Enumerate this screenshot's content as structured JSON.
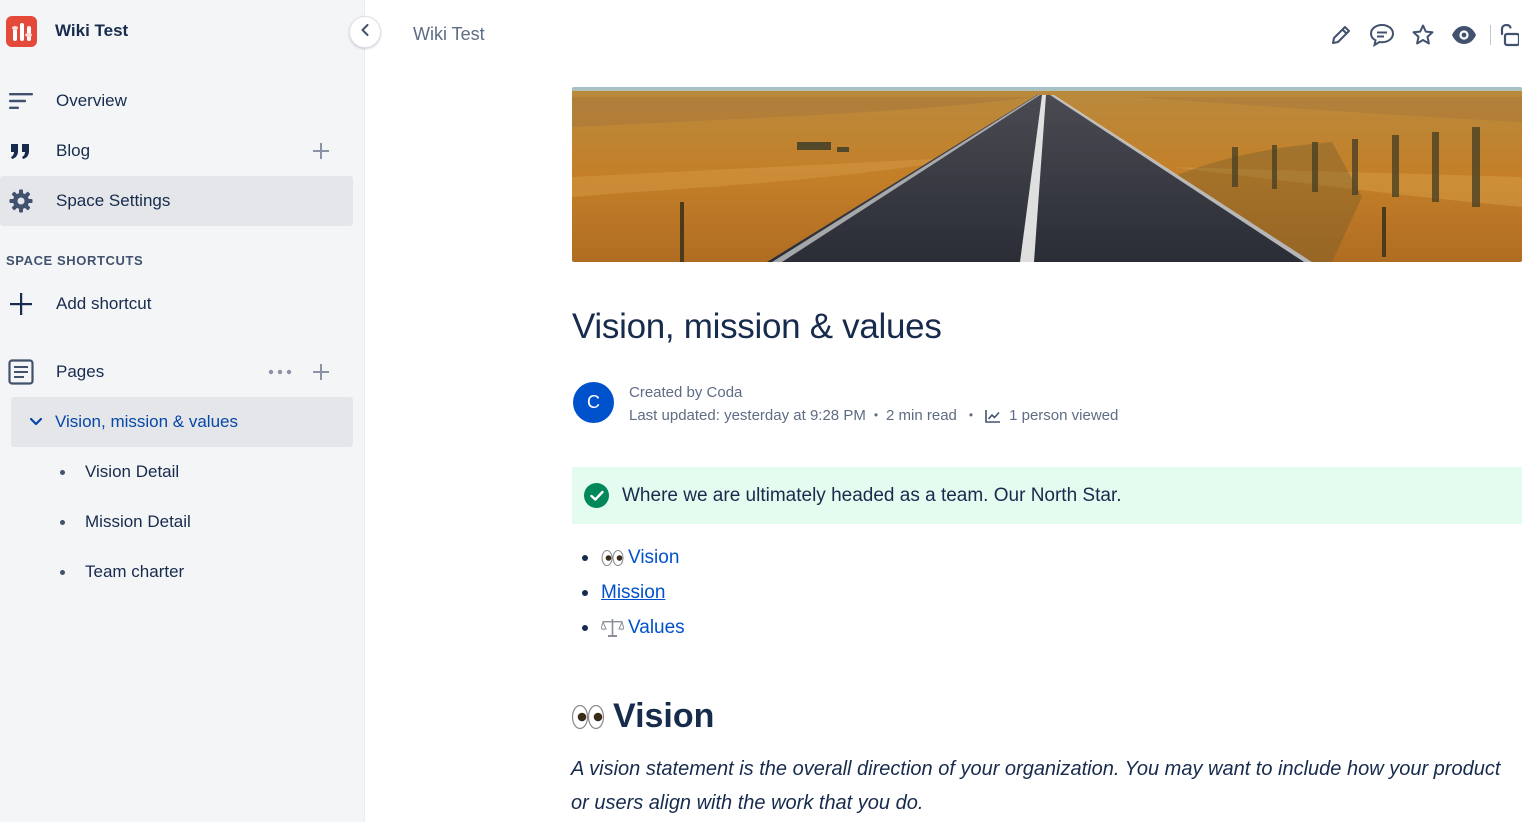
{
  "sidebar": {
    "space_name": "Wiki Test",
    "items": [
      {
        "label": "Overview",
        "icon": "overview-icon"
      },
      {
        "label": "Blog",
        "icon": "quote-icon"
      },
      {
        "label": "Space Settings",
        "icon": "gear-icon"
      }
    ],
    "shortcuts_title": "SPACE SHORTCUTS",
    "add_shortcut_label": "Add shortcut",
    "pages_label": "Pages",
    "tree": {
      "root": "Vision, mission & values",
      "children": [
        "Vision Detail",
        "Mission Detail",
        "Team charter"
      ]
    }
  },
  "header": {
    "breadcrumb": "Wiki Test",
    "toolbar": [
      "edit-icon",
      "comment-icon",
      "star-icon",
      "watch-icon",
      "restrictions-icon"
    ]
  },
  "page": {
    "title": "Vision, mission & values",
    "byline": {
      "avatar_initial": "C",
      "created": "Created by Coda",
      "updated": "Last updated: yesterday at 9:28 PM",
      "read_time": "2 min read",
      "views": "1 person viewed"
    },
    "panel_text": "Where we are ultimately headed as a team. Our North Star.",
    "toc": [
      {
        "label": "Vision",
        "emoji": "eyes"
      },
      {
        "label": " Mission",
        "emoji": ""
      },
      {
        "label": "Values",
        "emoji": "scales"
      }
    ],
    "section_heading": "Vision",
    "section_text": "A vision statement is the overall direction of your organization. You may want to include how your product or users align with the work that you do."
  }
}
